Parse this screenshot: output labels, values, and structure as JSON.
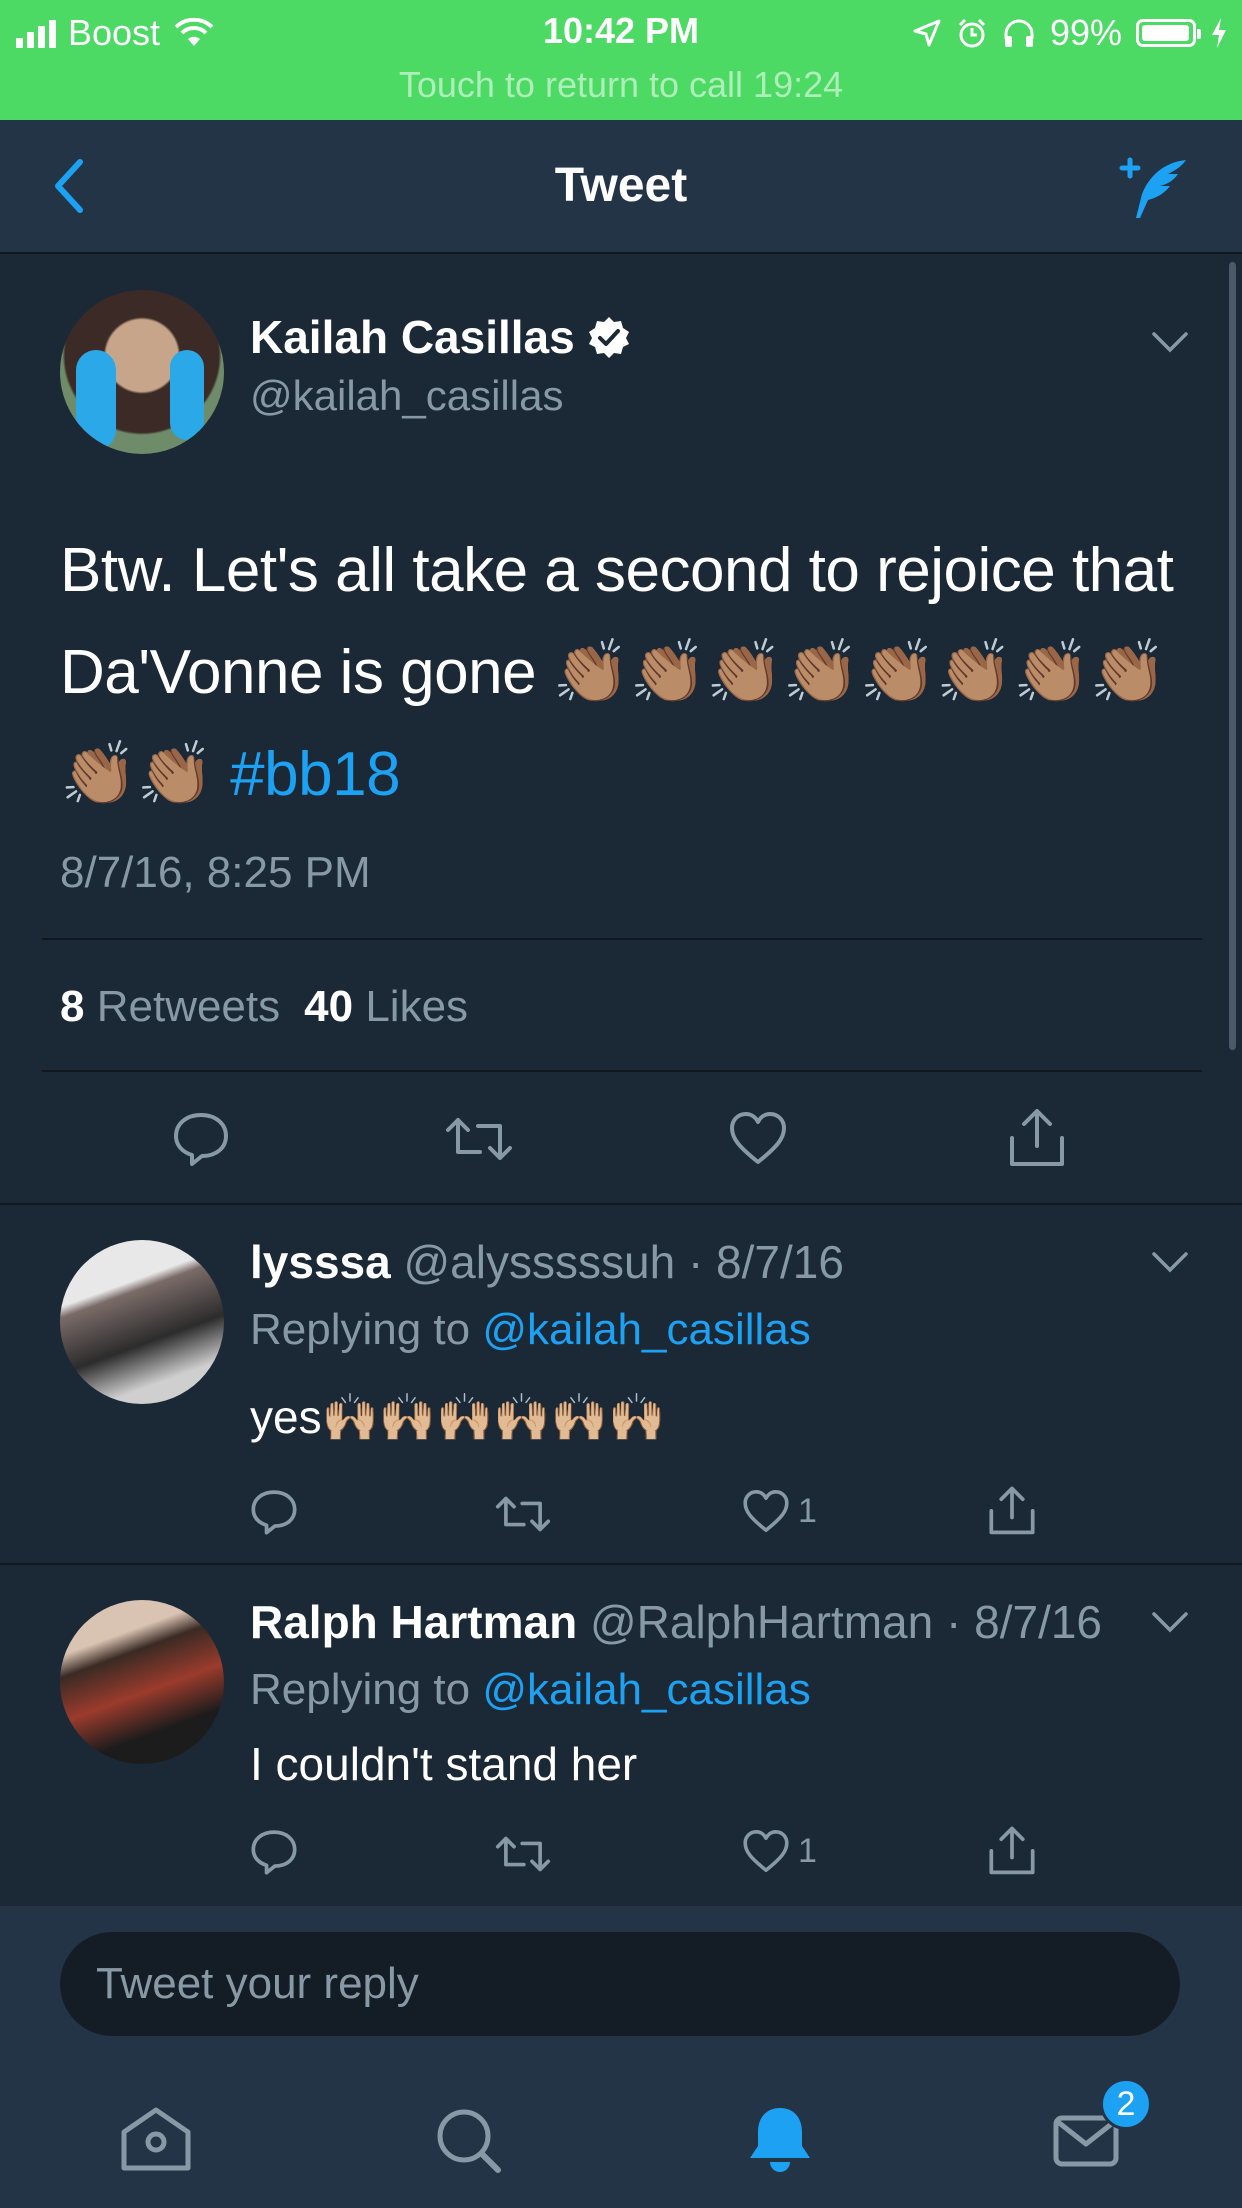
{
  "status_bar": {
    "carrier": "Boost",
    "time": "10:42 PM",
    "battery": "99%",
    "call_banner": "Touch to return to call 19:24"
  },
  "nav": {
    "title": "Tweet"
  },
  "tweet": {
    "author_name": "Kailah Casillas",
    "author_handle": "@kailah_casillas",
    "text": "Btw. Let's all take a second to rejoice that Da'Vonne is gone 👏🏽👏🏽👏🏽👏🏽👏🏽👏🏽👏🏽👏🏽👏🏽👏🏽",
    "hashtag": "#bb18",
    "timestamp": "8/7/16, 8:25 PM",
    "retweet_count": "8",
    "retweets_label": "Retweets",
    "like_count": "40",
    "likes_label": "Likes"
  },
  "replies": [
    {
      "name": "lysssa",
      "handle": "@alysssssuh",
      "date": "8/7/16",
      "replying_label": "Replying to",
      "replying_to": "@kailah_casillas",
      "text": "yes🙌🏼🙌🏼🙌🏼🙌🏼🙌🏼🙌🏼",
      "like_count": "1"
    },
    {
      "name": "Ralph Hartman",
      "handle": "@RalphHartman",
      "date": "8/7/16",
      "replying_label": "Replying to",
      "replying_to": "@kailah_casillas",
      "text": "I couldn't stand her",
      "like_count": "1"
    }
  ],
  "compose": {
    "placeholder": "Tweet your reply"
  },
  "tab_bar": {
    "messages_badge": "2"
  },
  "colors": {
    "accent": "#1da1f2",
    "background": "#1b2836",
    "secondary_text": "#8899a6",
    "status_bar": "#4cd964"
  }
}
